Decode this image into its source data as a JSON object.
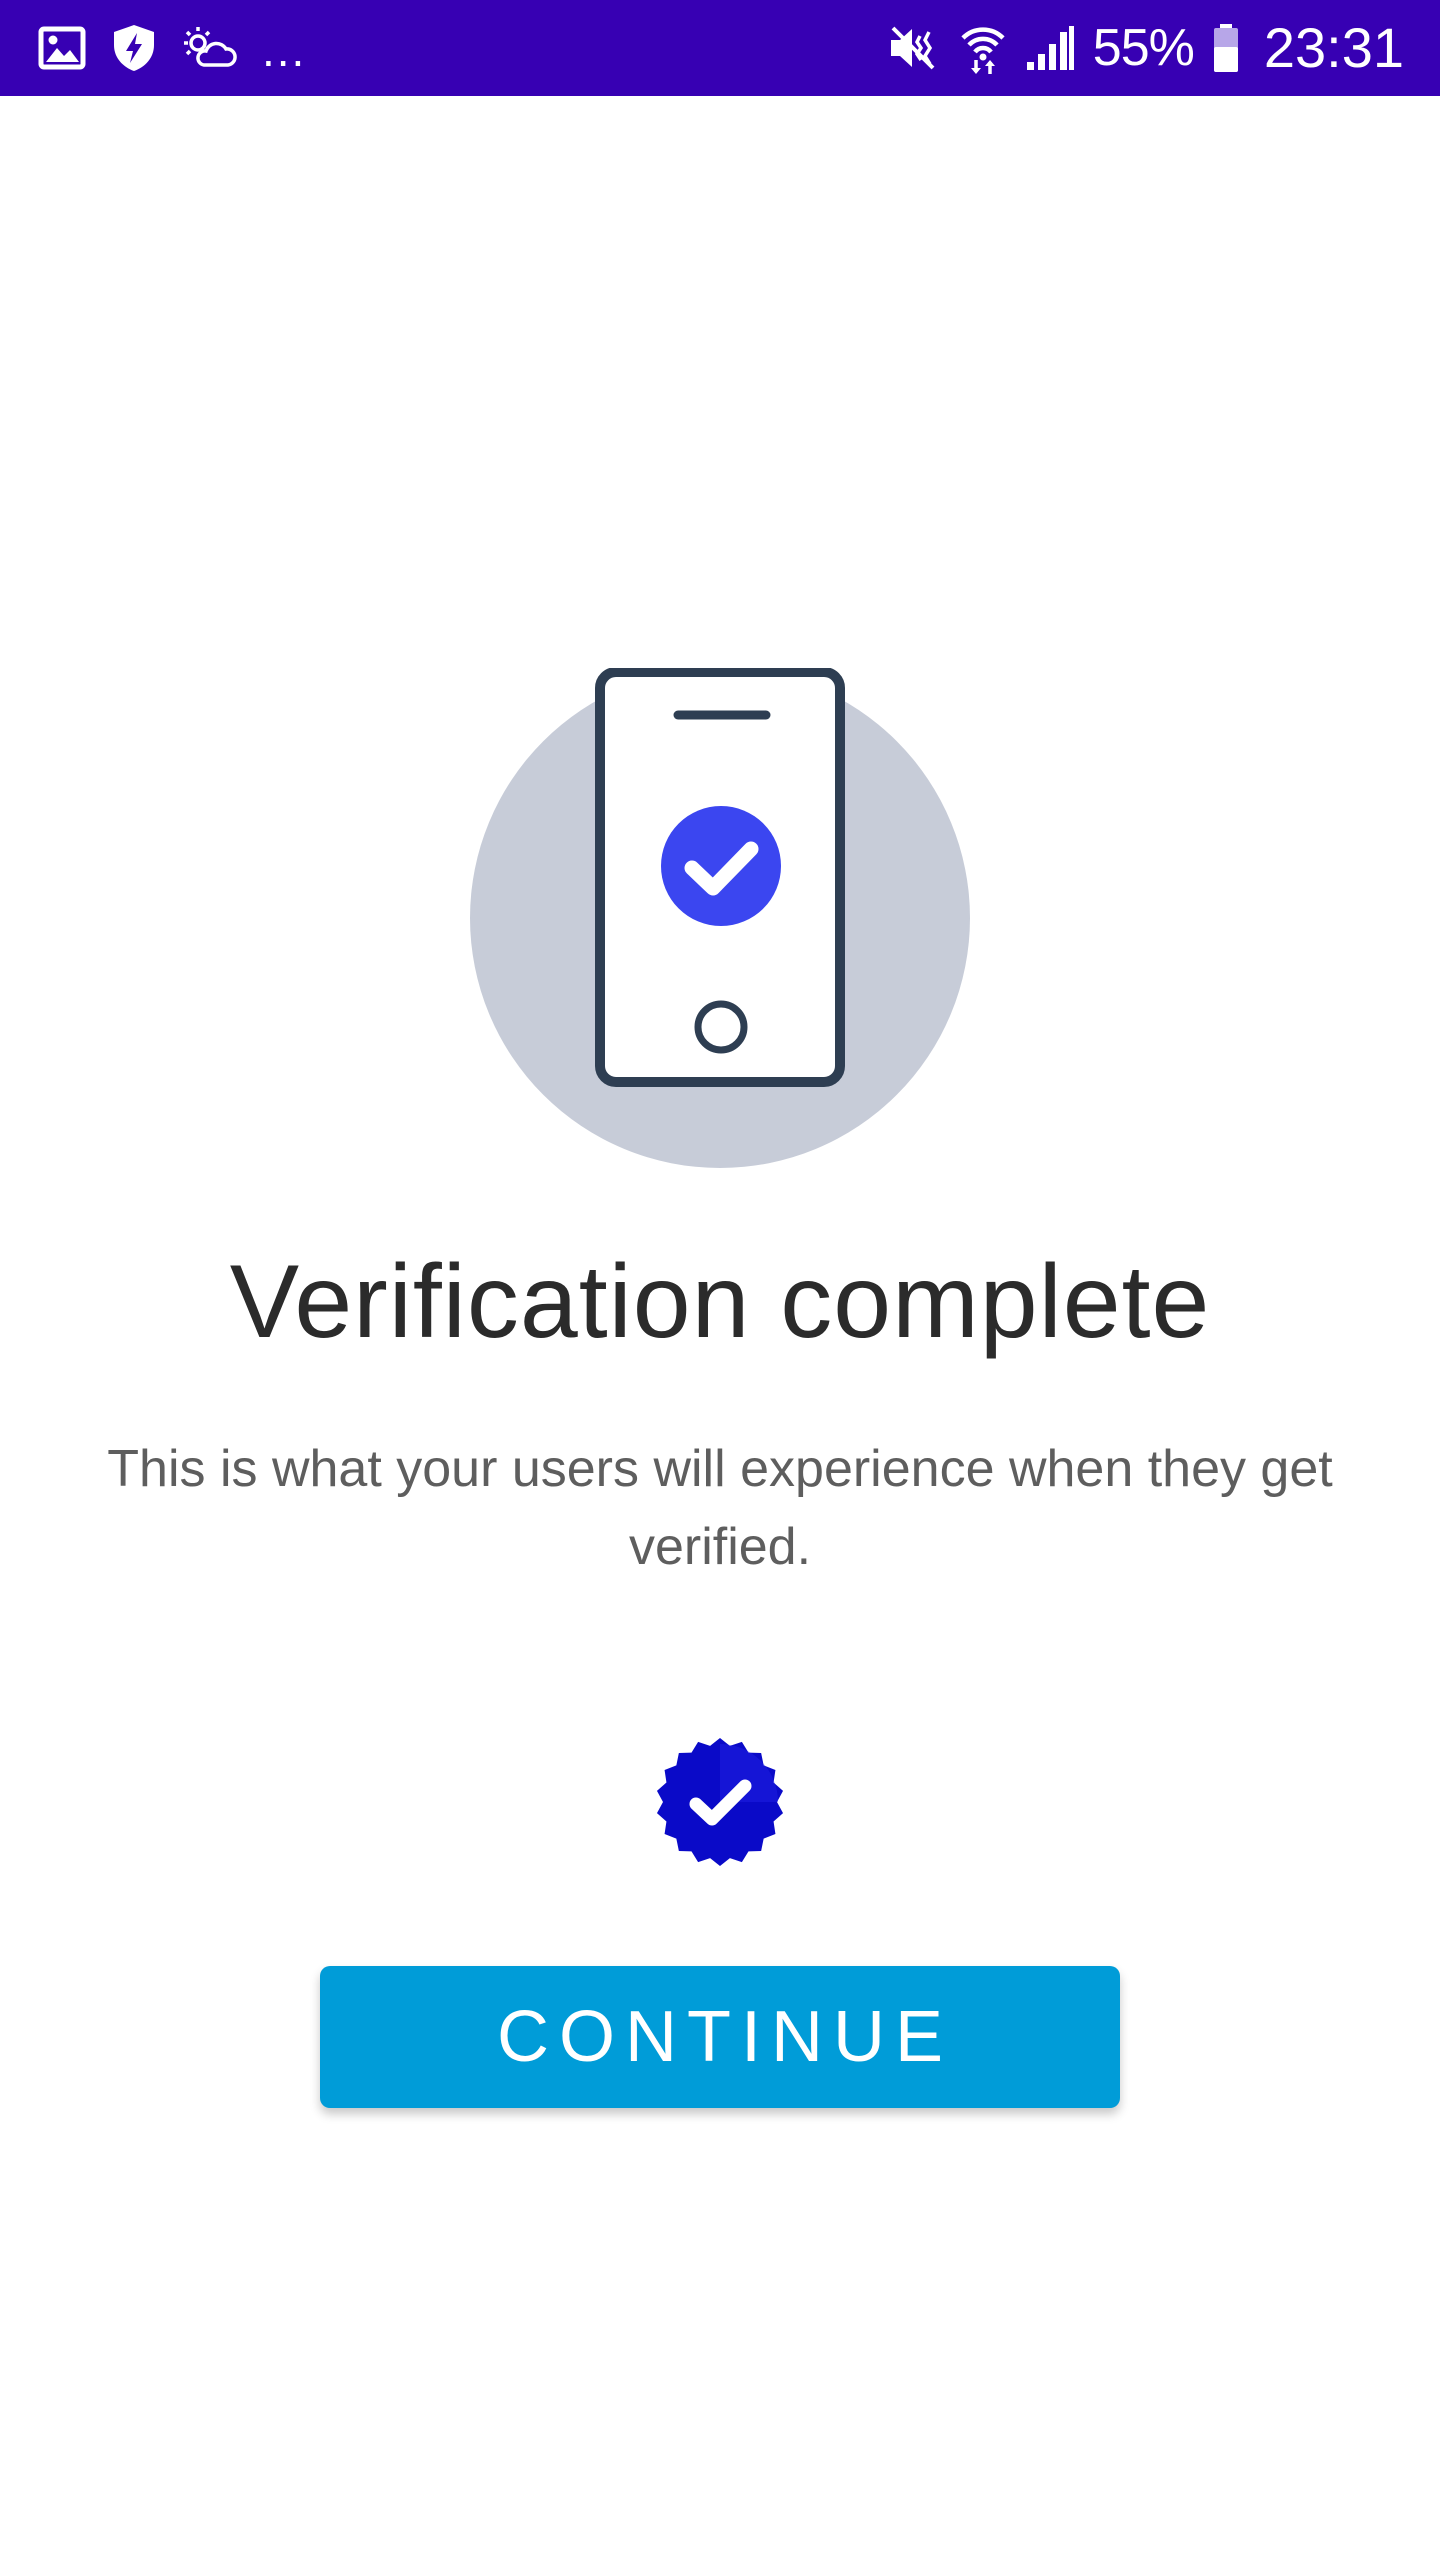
{
  "status_bar": {
    "icons_left": [
      "gallery-icon",
      "shield-bolt-icon",
      "weather-icon"
    ],
    "more": "...",
    "icons_right": [
      "mute-vibrate-icon",
      "wifi-icon",
      "signal-icon",
      "battery-icon"
    ],
    "battery": "55%",
    "time": "23:31",
    "background": "#3700b3"
  },
  "illustration": {
    "icon": "phone-check-icon",
    "circle_color": "#c7ccd8",
    "outline_color": "#2e3e52",
    "check_color": "#3b46f0"
  },
  "main": {
    "title": "Verification complete",
    "subtitle": "This is what your users will experience when they get verified."
  },
  "badge": {
    "icon": "verified-badge-icon",
    "color": "#0a0ac8"
  },
  "actions": {
    "continue_label": "CONTINUE",
    "button_color": "#009cd8"
  }
}
